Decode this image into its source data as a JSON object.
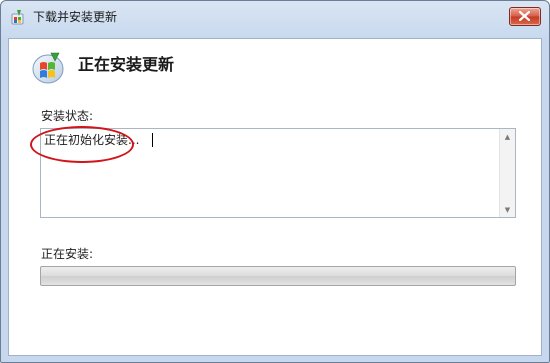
{
  "window": {
    "title": "下载并安装更新",
    "close_icon": "close-x-icon",
    "app_icon": "windows-update-icon"
  },
  "main": {
    "heading": "正在安装更新",
    "status_label": "安装状态:",
    "status_text": "正在初始化安装...",
    "installing_label": "正在安装:",
    "progress_value": 0,
    "annotation_color": "#d0151b"
  }
}
